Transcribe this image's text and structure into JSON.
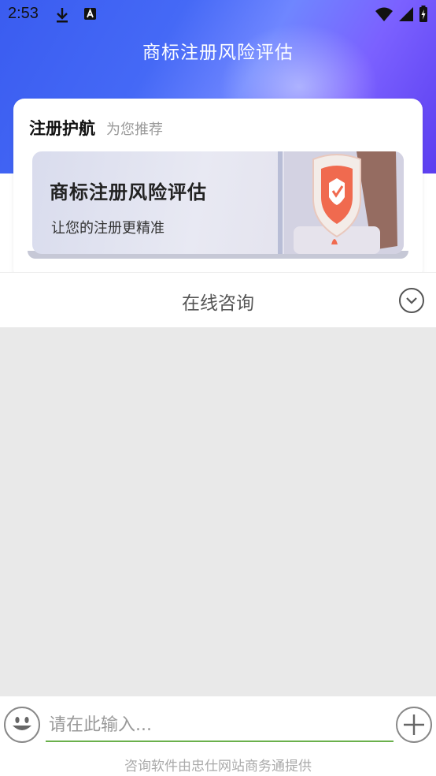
{
  "status_bar": {
    "time": "2:53",
    "left_icons": [
      "download-icon",
      "app-a-icon"
    ],
    "right_icons": [
      "wifi-icon",
      "signal-icon",
      "battery-icon"
    ]
  },
  "header": {
    "title": "商标注册风险评估"
  },
  "card": {
    "title": "注册护航",
    "subtitle": "为您推荐",
    "banner": {
      "title": "商标注册风险评估",
      "description": "让您的注册更精准"
    }
  },
  "consult": {
    "label": "在线咨询",
    "toggle_icon": "chevron-down-circle-icon"
  },
  "input_bar": {
    "placeholder": "请在此输入...",
    "value": "",
    "emoji_icon": "smiley-icon",
    "plus_icon": "plus-icon",
    "footer": "咨询软件由忠仕网站商务通提供"
  },
  "colors": {
    "header_gradient_start": "#3a5cf0",
    "header_gradient_end": "#5b3ef0",
    "chat_background": "#e9e9e9",
    "input_underline": "#6ab04c"
  }
}
